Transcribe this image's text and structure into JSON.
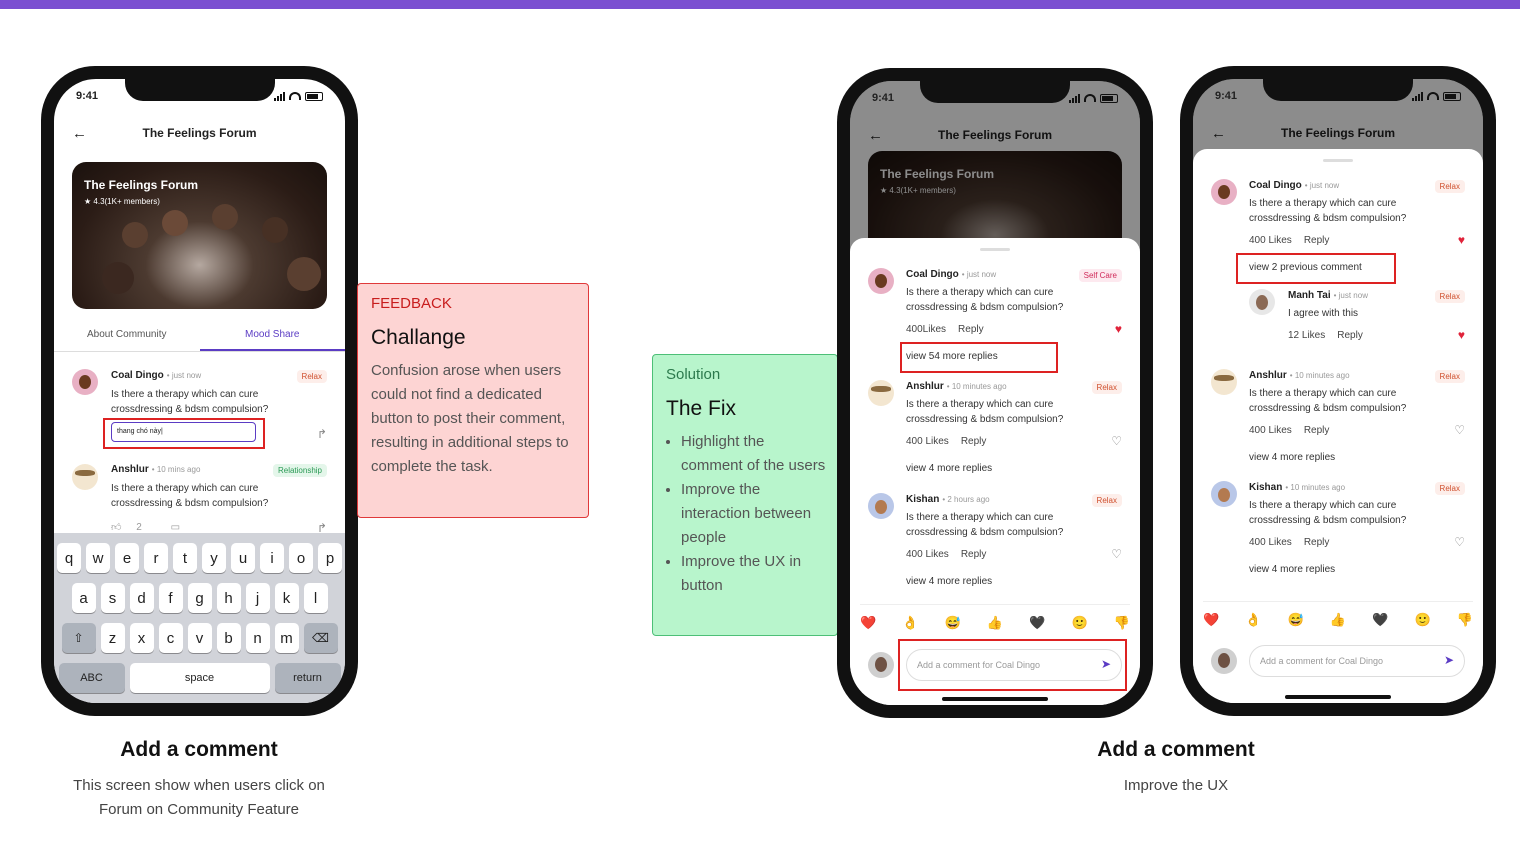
{
  "status_time": "9:41",
  "forum_title": "The Feelings Forum",
  "hero": {
    "title": "The Feelings Forum",
    "rating": "★ 4.3(1K+ members)"
  },
  "tabs": [
    "About Community",
    "Mood Share"
  ],
  "comments": {
    "coal": {
      "name": "Coal Dingo",
      "time": "just now",
      "text1": "Is there a therapy which can cure",
      "text2": "crossdressing & bdsm compulsion?"
    },
    "anshlur": {
      "name": "Anshlur",
      "time_short": "10 mins ago",
      "time": "10 minutes ago"
    },
    "kishan": {
      "name": "Kishan",
      "time": "2 hours ago"
    },
    "manh": {
      "name": "Manh Tai",
      "time": "just now",
      "text": "I agree with this",
      "likes": "12 Likes"
    }
  },
  "tags": {
    "relax": "Relax",
    "self_care": "Self Care",
    "relationship": "Relationship"
  },
  "phone1": {
    "input_value": "thang chó này|",
    "like_count": "2"
  },
  "meta": {
    "likes_400": "400 Likes",
    "likes_400_nospace": "400Likes",
    "reply": "Reply"
  },
  "links": {
    "view_54": "view 54 more replies",
    "view_4": "view 4 more replies",
    "view_prev": "view 2 previous comment"
  },
  "emojis": [
    "❤️",
    "👌",
    "😅",
    "👍",
    "🖤",
    "🙂",
    "👎"
  ],
  "comment_placeholder": "Add a comment for Coal Dingo",
  "keyboard": {
    "row1": [
      "q",
      "w",
      "e",
      "r",
      "t",
      "y",
      "u",
      "i",
      "o",
      "p"
    ],
    "row2": [
      "a",
      "s",
      "d",
      "f",
      "g",
      "h",
      "j",
      "k",
      "l"
    ],
    "row3": [
      "z",
      "x",
      "c",
      "v",
      "b",
      "n",
      "m"
    ],
    "abc": "ABC",
    "space": "space",
    "return": "return"
  },
  "feedback": {
    "label": "FEEDBACK",
    "title": "Challange",
    "body": "Confusion arose when users could not find a dedicated button to post their comment, resulting in additional steps to complete the task."
  },
  "solution": {
    "label": "Solution",
    "title": "The Fix",
    "items": [
      "Highlight the comment of the users",
      "Improve the interaction between people",
      "Improve the UX in button"
    ]
  },
  "captions": {
    "left_title": "Add a comment",
    "left_sub1": "This screen show when users click on",
    "left_sub2": "Forum on Community Feature",
    "right_title": "Add a comment",
    "right_sub": "Improve the UX"
  }
}
